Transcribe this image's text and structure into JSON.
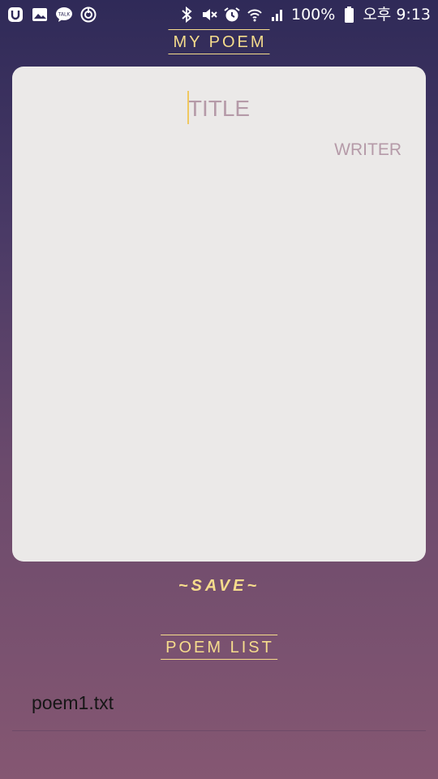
{
  "status_bar": {
    "left_icons": [
      "u-plus-icon",
      "gallery-icon",
      "kakaotalk-icon",
      "sync-icon"
    ],
    "kakaotalk_badge": "TALK",
    "right_icons": [
      "bluetooth-icon",
      "mute-icon",
      "alarm-icon",
      "wifi-icon",
      "signal-icon",
      "battery-icon"
    ],
    "battery_text": "100%",
    "time_text": "오후 9:13"
  },
  "header": {
    "title": "MY POEM"
  },
  "editor": {
    "title_placeholder": "TITLE",
    "writer_placeholder": "WRITER",
    "body_placeholder": ""
  },
  "save_label": "~SAVE~",
  "list_section": {
    "title": "POEM LIST",
    "items": [
      "poem1.txt"
    ]
  },
  "colors": {
    "accent": "#f6dc8c",
    "card": "#ebe9e8",
    "placeholder": "#b59aa8",
    "gradient_top": "#2f2a58",
    "gradient_bottom": "#855772"
  }
}
